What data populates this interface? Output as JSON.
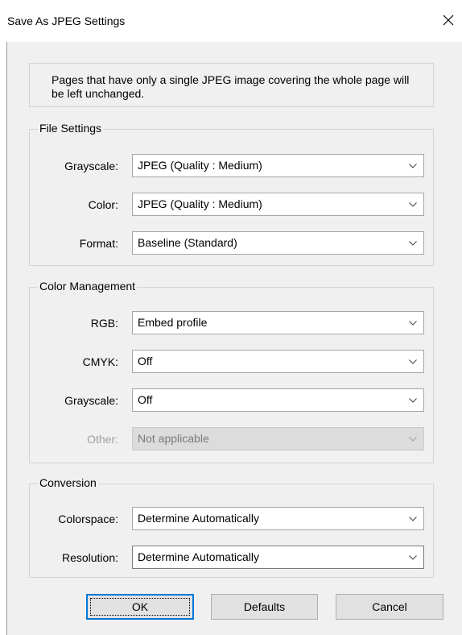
{
  "window": {
    "title": "Save As JPEG Settings",
    "close_icon": "close-icon"
  },
  "info": {
    "text": "Pages that have only a single JPEG image covering the whole page will be left unchanged."
  },
  "file_settings": {
    "title": "File Settings",
    "rows": [
      {
        "label": "Grayscale:",
        "value": "JPEG (Quality : Medium)"
      },
      {
        "label": "Color:",
        "value": "JPEG (Quality : Medium)"
      },
      {
        "label": "Format:",
        "value": "Baseline (Standard)"
      }
    ]
  },
  "color_management": {
    "title": "Color Management",
    "rows": [
      {
        "label": "RGB:",
        "value": "Embed profile",
        "enabled": true
      },
      {
        "label": "CMYK:",
        "value": "Off",
        "enabled": true
      },
      {
        "label": "Grayscale:",
        "value": "Off",
        "enabled": true
      },
      {
        "label": "Other:",
        "value": "Not applicable",
        "enabled": false
      }
    ]
  },
  "conversion": {
    "title": "Conversion",
    "rows": [
      {
        "label": "Colorspace:",
        "value": "Determine Automatically"
      },
      {
        "label": "Resolution:",
        "value": "Determine Automatically"
      }
    ]
  },
  "buttons": {
    "ok": "OK",
    "defaults": "Defaults",
    "cancel": "Cancel"
  },
  "colors": {
    "focus_border": "#0078d7",
    "dialog_bg": "#f0f0f0"
  }
}
